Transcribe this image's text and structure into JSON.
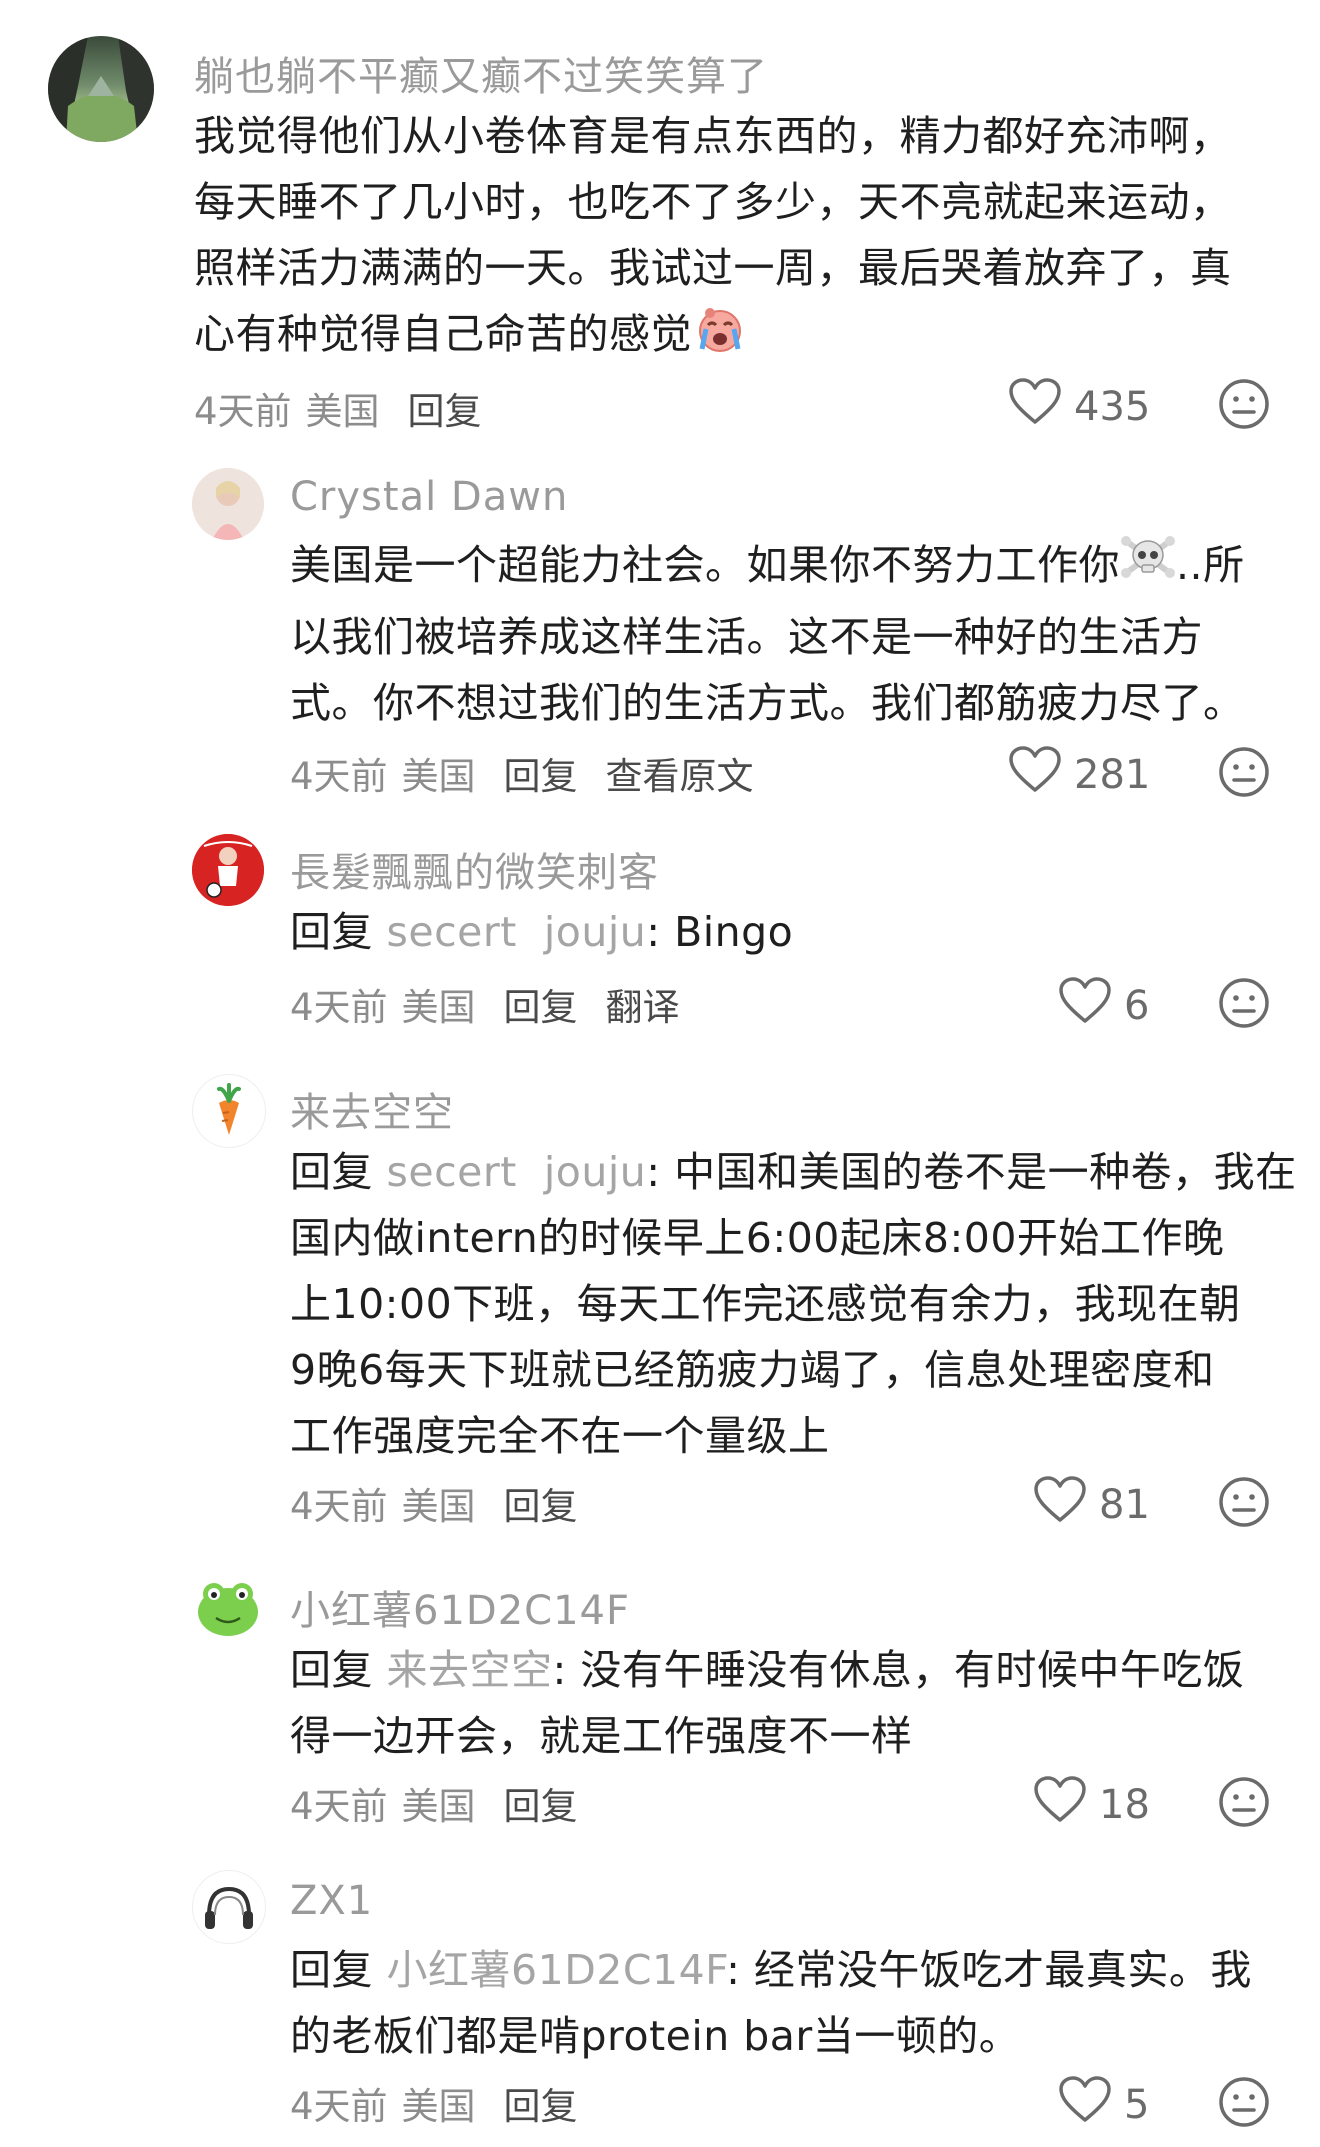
{
  "comments": [
    {
      "username": "躺也躺不平癫又癫不过笑笑算了",
      "lines": [
        "我觉得他们从小卷体育是有点东西的，精力都好充沛啊，",
        "每天睡不了几小时，也吃不了多少，天不亮就起来运动，",
        "照样活力满满的一天。我试过一周，最后哭着放弃了，真",
        "心有种觉得自己命苦的感觉"
      ],
      "emoji": "crying-face-emoji",
      "time": "4天前",
      "location": "美国",
      "reply_label": "回复",
      "likes": "435"
    },
    {
      "username": "Crystal Dawn",
      "lines": [
        "美国是一个超能力社会。如果你不努力工作你",
        "以我们被培养成这样生活。这不是一种好的生活方",
        "式。你不想过我们的生活方式。我们都筋疲力尽了。"
      ],
      "line1_suffix": "..所",
      "emoji": "skull-crossbones-emoji",
      "time": "4天前",
      "location": "美国",
      "reply_label": "回复",
      "extra_action": "查看原文",
      "likes": "281"
    },
    {
      "username": "長髮飄飄的微笑刺客",
      "reply_prefix": "回复",
      "mention": "secert  jouju",
      "text": ": Bingo",
      "time": "4天前",
      "location": "美国",
      "reply_label": "回复",
      "extra_action": "翻译",
      "likes": "6"
    },
    {
      "username": "来去空空",
      "reply_prefix": "回复",
      "mention": "secert  jouju",
      "first_line_text": ": 中国和美国的卷不是一种卷，我在",
      "lines": [
        "国内做intern的时候早上6:00起床8:00开始工作晚",
        "上10:00下班，每天工作完还感觉有余力，我现在朝",
        "9晚6每天下班就已经筋疲力竭了，信息处理密度和",
        "工作强度完全不在一个量级上"
      ],
      "time": "4天前",
      "location": "美国",
      "reply_label": "回复",
      "likes": "81"
    },
    {
      "username": "小红薯61D2C14F",
      "reply_prefix": "回复",
      "mention": "来去空空",
      "first_line_text": ": 没有午睡没有休息，有时候中午吃饭",
      "lines": [
        "得一边开会，就是工作强度不一样"
      ],
      "time": "4天前",
      "location": "美国",
      "reply_label": "回复",
      "likes": "18"
    },
    {
      "username": "ZX1",
      "reply_prefix": "回复",
      "mention": "小红薯61D2C14F",
      "first_line_text": ": 经常没午饭吃才最真实。我",
      "lines": [
        "的老板们都是啃protein bar当一顿的。"
      ],
      "time": "4天前",
      "location": "美国",
      "reply_label": "回复",
      "likes": "5"
    }
  ],
  "icons": {
    "like": "heart-outline-icon",
    "dislike": "unhappy-face-icon"
  },
  "colors": {
    "username": "#9a9a9a",
    "text": "#1f1f1f",
    "meta": "#8c8c8c",
    "icon": "#6b6b6b"
  }
}
